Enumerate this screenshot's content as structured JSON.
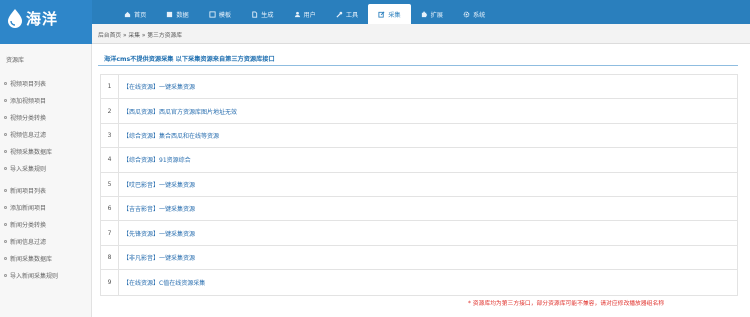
{
  "brand": {
    "name": "海洋",
    "color": "#2a7fbd",
    "accent_red": "#e0302b"
  },
  "nav": {
    "items": [
      {
        "label": "首页",
        "icon": "home-icon"
      },
      {
        "label": "数据",
        "icon": "book-icon"
      },
      {
        "label": "模板",
        "icon": "template-icon"
      },
      {
        "label": "生成",
        "icon": "file-icon"
      },
      {
        "label": "用户",
        "icon": "user-icon"
      },
      {
        "label": "工具",
        "icon": "wrench-icon"
      },
      {
        "label": "采集",
        "icon": "edit-icon",
        "active": true
      },
      {
        "label": "扩展",
        "icon": "puzzle-icon"
      },
      {
        "label": "系统",
        "icon": "gear-icon"
      }
    ]
  },
  "breadcrumb": "后台首页 » 采集 » 第三方资源库",
  "sidebar": {
    "head": "资源库",
    "groups": [
      [
        "视频项目列表",
        "添加视频项目",
        "视频分类转换",
        "视频信息过滤",
        "视频采集数据库",
        "导入采集规则"
      ],
      [
        "新闻项目列表",
        "添加新闻项目",
        "新闻分类转换",
        "新闻信息过滤",
        "新闻采集数据库",
        "导入新闻采集规则"
      ]
    ]
  },
  "notice": "海洋cms不提供资源采集 以下采集资源来自第三方资源库接口",
  "resources": [
    {
      "num": "1",
      "label": "【在线资源】一键采集资源"
    },
    {
      "num": "2",
      "label": "【西瓜资源】西瓜官方资源库图片地址无效"
    },
    {
      "num": "3",
      "label": "【综合资源】集合西瓜和在线等资源"
    },
    {
      "num": "4",
      "label": "【综合资源】91资源综合"
    },
    {
      "num": "5",
      "label": "【哎巴影音】一键采集资源"
    },
    {
      "num": "6",
      "label": "【吉吉影音】一键采集资源"
    },
    {
      "num": "7",
      "label": "【先锋资源】一键采集资源"
    },
    {
      "num": "8",
      "label": "【非凡影音】一键采集资源"
    },
    {
      "num": "9",
      "label": "【在线资源】C值在线资源采集"
    }
  ],
  "footnote": "* 资源库均为第三方接口，部分资源库可能不兼容，请对应修改播放器组名称"
}
